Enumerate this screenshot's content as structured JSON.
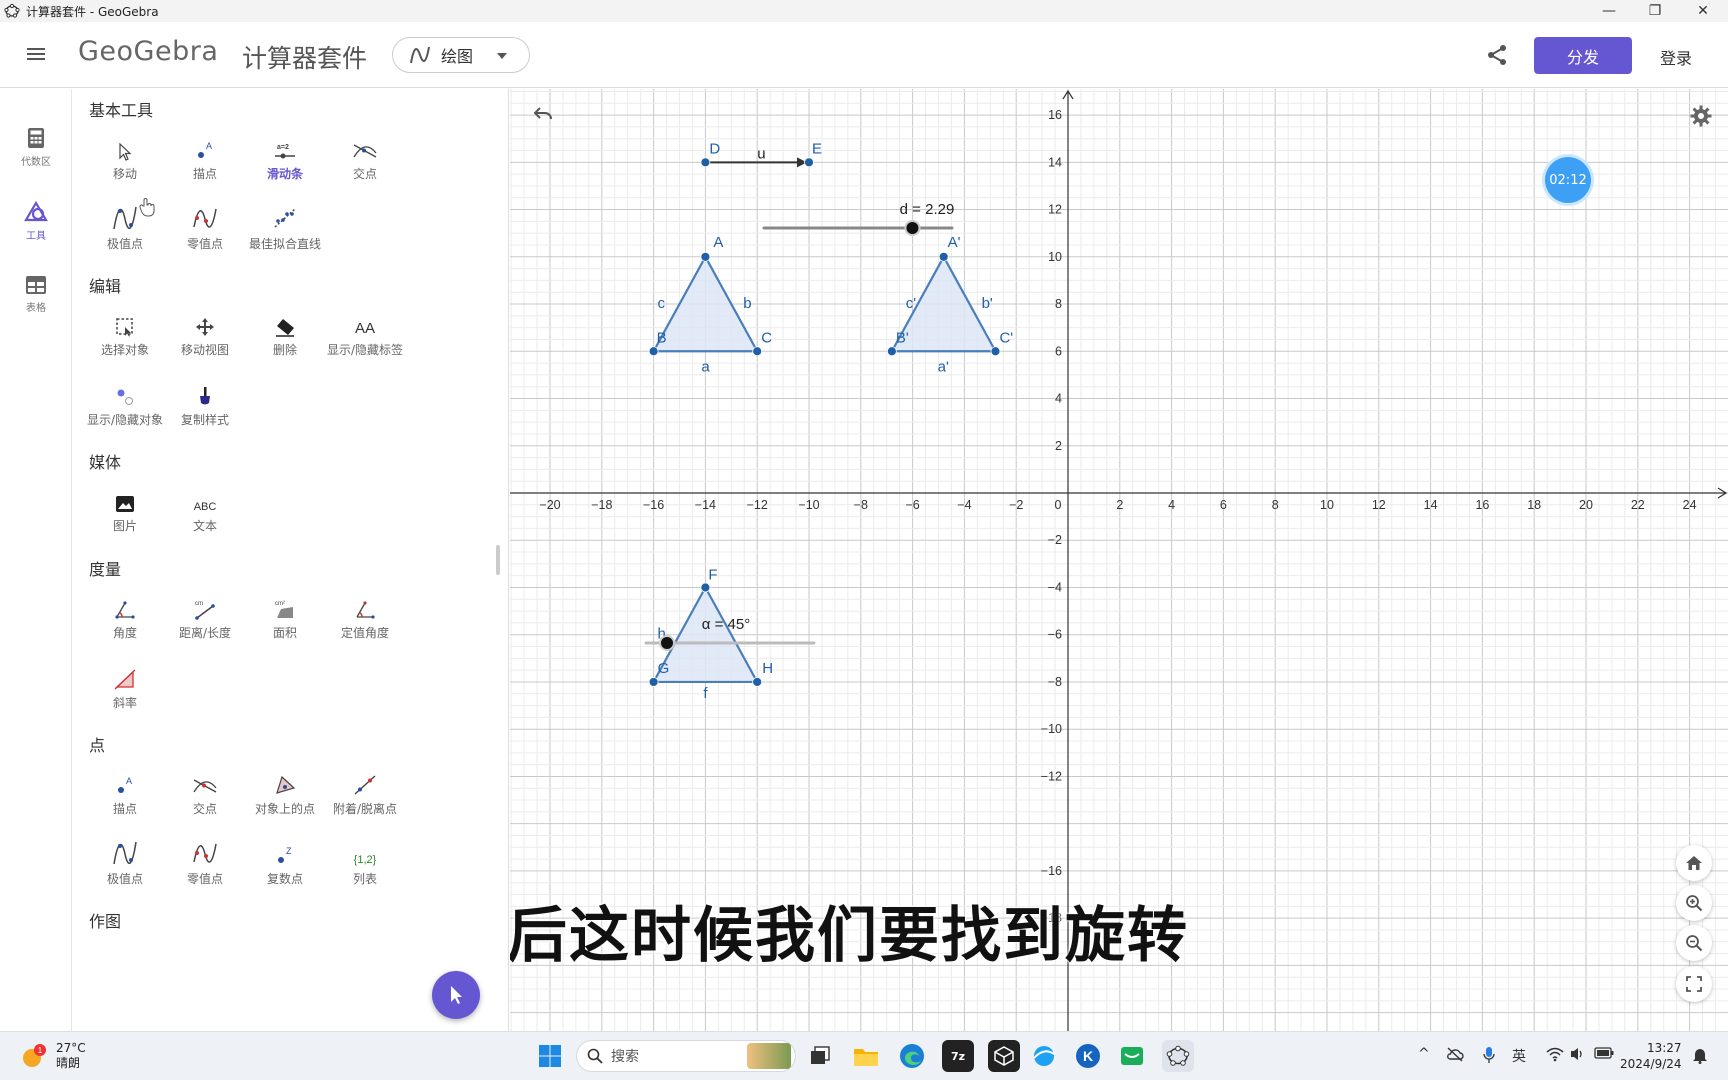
{
  "window": {
    "title": "计算器套件 - GeoGebra",
    "controls": [
      "—",
      "❐",
      "✕"
    ]
  },
  "header": {
    "logo": "GeoGebra",
    "suite_title": "计算器套件",
    "app_switch_label": "绘图",
    "share_icon": "share-icon",
    "distribute_label": "分发",
    "login_label": "登录"
  },
  "rail": {
    "items": [
      {
        "label": "代数区",
        "icon": "calculator-icon"
      },
      {
        "label": "工具",
        "icon": "shapes-icon"
      },
      {
        "label": "表格",
        "icon": "table-icon"
      }
    ]
  },
  "tools": {
    "sections": [
      {
        "title": "基本工具",
        "items": [
          "移动",
          "描点",
          "滑动条",
          "交点",
          "极值点",
          "零值点",
          "最佳拟合直线"
        ]
      },
      {
        "title": "编辑",
        "items": [
          "选择对象",
          "移动视图",
          "删除",
          "显示/隐藏标签",
          "显示/隐藏对象",
          "复制样式"
        ]
      },
      {
        "title": "媒体",
        "items": [
          "图片",
          "文本"
        ]
      },
      {
        "title": "度量",
        "items": [
          "角度",
          "距离/长度",
          "面积",
          "定值角度",
          "斜率"
        ]
      },
      {
        "title": "点",
        "items": [
          "描点",
          "交点",
          "对象上的点",
          "附着/脱离点",
          "极值点",
          "零值点",
          "复数点",
          "列表"
        ]
      },
      {
        "title": "作图",
        "items": []
      }
    ],
    "text_icons": {
      "abc": "ABC",
      "list": "{1,2}",
      "slider": "a=2",
      "label": "AA"
    }
  },
  "graphics": {
    "x_ticks": [
      "−20",
      "−18",
      "−16",
      "−14",
      "−12",
      "−10",
      "−8",
      "−6",
      "−4",
      "−2",
      "0",
      "2",
      "4",
      "6",
      "8",
      "10",
      "12",
      "14",
      "16",
      "18",
      "20",
      "22",
      "24"
    ],
    "y_ticks": [
      "16",
      "14",
      "12",
      "10",
      "8",
      "6",
      "4",
      "2",
      "−2",
      "−4",
      "−6",
      "−8",
      "−10",
      "−12",
      "−16",
      "−18"
    ],
    "points": {
      "A": [
        -14,
        10
      ],
      "B": [
        -16,
        6
      ],
      "C": [
        -12,
        6
      ],
      "A'": [
        -4.8,
        10
      ],
      "B'": [
        -6.8,
        6
      ],
      "C'": [
        -2.8,
        6
      ],
      "F": [
        -14,
        -4
      ],
      "G": [
        -16,
        -8
      ],
      "H": [
        -12,
        -8
      ],
      "D": [
        -14,
        14
      ],
      "E": [
        -10,
        14
      ]
    },
    "segment_labels": {
      "a": "a",
      "b": "b",
      "c": "c",
      "a'": "a'",
      "b'": "b'",
      "c'": "c'",
      "f": "f",
      "h": "h"
    },
    "vector_label": "u",
    "slider_d_label": "d = 2.29",
    "slider_d_value": 2.29,
    "slider_alpha_label": "α = 45°",
    "slider_alpha_value": 45,
    "timer": "02:12",
    "subtitle": "然后这时候我们要找到旋转",
    "colors": {
      "shape_stroke": "#4a7ebb",
      "shape_fill": "#dce6f5",
      "point": "#1f5fa8",
      "accent": "#6557d2"
    }
  },
  "taskbar": {
    "weather_temp": "27°C",
    "weather_desc": "晴朗",
    "weather_badge": "1",
    "search_placeholder": "搜索",
    "ime": "英",
    "time": "13:27",
    "date": "2024/9/24"
  }
}
